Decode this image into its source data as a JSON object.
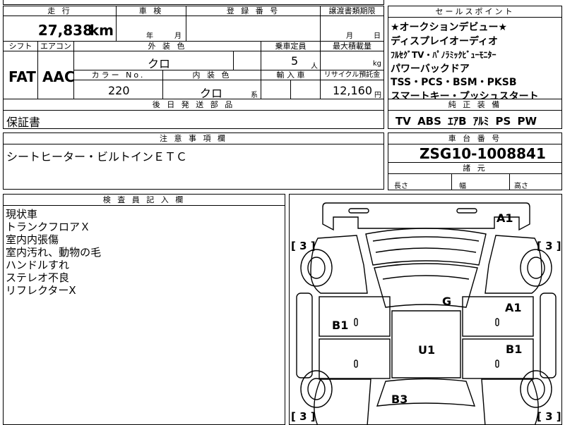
{
  "header": {
    "mileage": "走 行",
    "inspection": "車 検",
    "registration": "登 録 番 号",
    "transfer_deadline": "譲渡書類期限",
    "selling_points": "セールスポイント",
    "shift": "シフト",
    "aircon": "エアコン",
    "exterior_color": "外 装 色",
    "capacity": "乗車定員",
    "max_load": "最大積載量",
    "color_no": "カラー No.",
    "interior_color": "内 装 色",
    "imported": "輸 入 車",
    "recycle_fee": "リサイクル預託金",
    "later_parts": "後 日 発 送 部 品",
    "standard_equipment": "純 正 装 備",
    "notes": "注 意 事 項 欄",
    "chassis_number": "車 台 番 号",
    "specs": "諸 元",
    "inspector_notes": "検 査 員 記 入 欄"
  },
  "values": {
    "mileage": "27,838",
    "mileage_unit": "km",
    "inspection_year": "年",
    "inspection_month": "月",
    "transfer_month": "月",
    "transfer_day": "日",
    "shift": "FAT",
    "aircon": "AAC",
    "exterior_color": "クロ",
    "capacity": "5",
    "capacity_unit": "人",
    "max_load_unit": "kg",
    "color_no": "220",
    "interior_color": "クロ",
    "interior_suffix": "系",
    "recycle_fee": "12,160",
    "recycle_unit": "円",
    "later_parts": "保証書",
    "standard_equipment": "TV ABS ｴｱB ｱﾙﾐ PS PW",
    "notes": "シートヒーター・ビルトインＥＴＣ",
    "chassis_number": "ZSG10-1008841",
    "spec_length": "長さ",
    "spec_width": "幅",
    "spec_height": "高さ"
  },
  "selling_points": [
    "★オークションデビュー★",
    "ディスプレイオーディオ",
    "ﾌﾙｾｸﾞTV・ﾊﾟﾉﾗﾐｯｸﾋﾞｭｰﾓﾆﾀｰ",
    "パワーバックドア",
    "TSS・PCS・BSM・PKSB",
    "スマートキー・プッシュスタート"
  ],
  "inspector_notes": [
    "現状車",
    "トランクフロアＸ",
    "室内内張傷",
    "室内汚れ、動物の毛",
    "ハンドルすれ",
    "ステレオ不良",
    "リフレクターX"
  ],
  "diagram": {
    "top_left_bracket": "[ 3 ]",
    "top_right_bracket": "[ 3 ]",
    "bottom_left_bracket": "[ 3 ]",
    "bottom_right_bracket": "[ 3 ]",
    "marks": {
      "a1_top": "A1",
      "g": "G",
      "a1_right": "A1",
      "b1_left": "B1",
      "u1": "U1",
      "b1_right": "B1",
      "b3": "B3"
    }
  }
}
